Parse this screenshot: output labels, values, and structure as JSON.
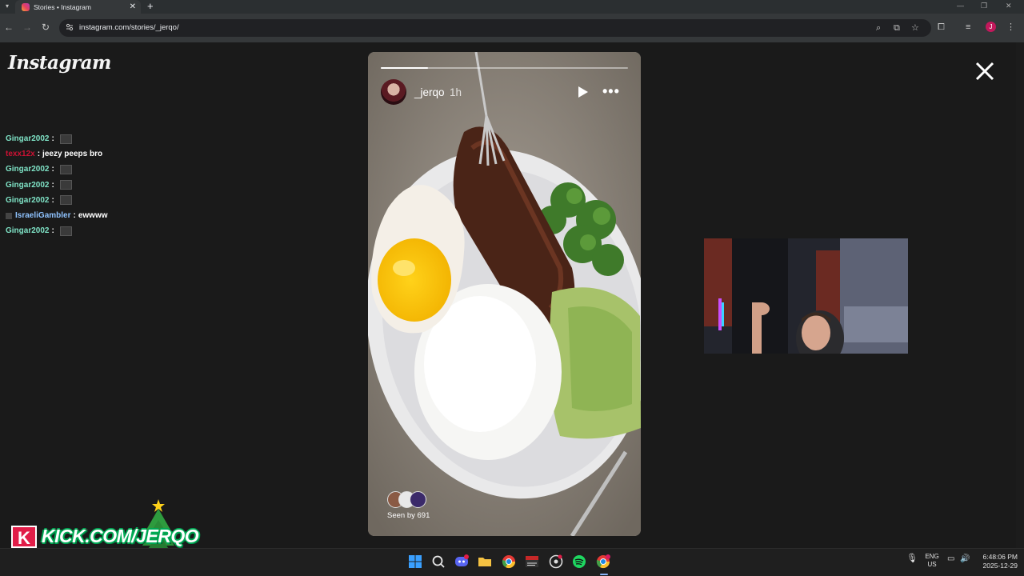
{
  "browser": {
    "tab_title": "Stories • Instagram",
    "tab_close": "✕",
    "new_tab": "+",
    "url": "instagram.com/stories/_jerqo/",
    "profile_initial": "J"
  },
  "page": {
    "logo": "Instagram",
    "close": "✕"
  },
  "chat": [
    {
      "user": "Gingar2002",
      "user_color": "#7fe3c6",
      "sep": ":",
      "message": "",
      "emote": true,
      "badge": false
    },
    {
      "user": "texx12x",
      "user_color": "#cc1133",
      "sep": ":",
      "message": "jeezy peeps bro",
      "emote": false,
      "badge": false
    },
    {
      "user": "Gingar2002",
      "user_color": "#7fe3c6",
      "sep": ":",
      "message": "",
      "emote": true,
      "badge": false
    },
    {
      "user": "Gingar2002",
      "user_color": "#7fe3c6",
      "sep": ":",
      "message": "",
      "emote": true,
      "badge": false
    },
    {
      "user": "Gingar2002",
      "user_color": "#7fe3c6",
      "sep": ":",
      "message": "",
      "emote": true,
      "badge": false
    },
    {
      "user": "IsraeliGambler",
      "user_color": "#8fc3ff",
      "sep": ":",
      "message": "ewwww",
      "emote": false,
      "badge": true
    },
    {
      "user": "Gingar2002",
      "user_color": "#7fe3c6",
      "sep": ":",
      "message": "",
      "emote": true,
      "badge": false
    }
  ],
  "story": {
    "username": "_jerqo",
    "time": "1h",
    "progress": 0.19,
    "more": "•••",
    "seen_by": "Seen by 691"
  },
  "overlay": {
    "kick_text": "KICK.COM/JERQO",
    "kick_k": "K"
  },
  "tray": {
    "lang": "ENG",
    "region": "US",
    "time": "6:48:06 PM",
    "date": "2025-12-29"
  }
}
